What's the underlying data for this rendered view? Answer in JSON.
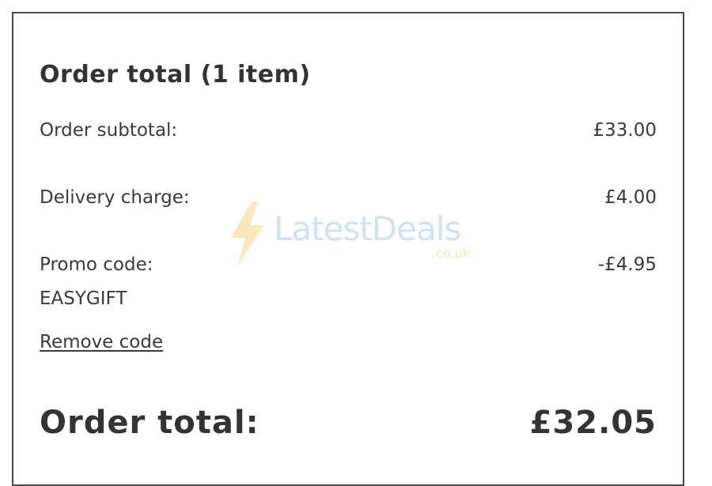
{
  "summary": {
    "title": "Order total (1 item)",
    "subtotal_label": "Order subtotal:",
    "subtotal_value": "£33.00",
    "delivery_label": "Delivery charge:",
    "delivery_value": "£4.00",
    "promo_label": "Promo code:",
    "promo_value": "-£4.95",
    "promo_code": "EASYGIFT",
    "remove_label": "Remove code",
    "total_label": "Order total:",
    "total_value": "£32.05"
  },
  "watermark": {
    "brand": "LatestDeals",
    "domain": ".co.uk",
    "icon": "lightning-bolt-icon"
  },
  "colors": {
    "text": "#333333",
    "border": "#4a4a4a",
    "watermark_blue": "#5aa0e6",
    "watermark_yellow": "#f2b21b"
  }
}
